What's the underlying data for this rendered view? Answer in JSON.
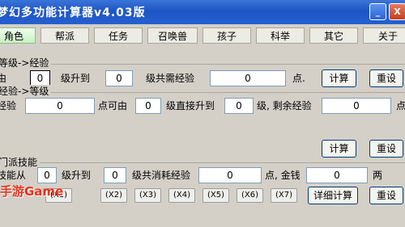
{
  "window": {
    "title": "梦幻多功能计算器v4.03版",
    "minimize_label": "_",
    "close_label": "X"
  },
  "tabs": [
    "角色",
    "帮派",
    "任务",
    "召唤兽",
    "孩子",
    "科举",
    "其它",
    "关于"
  ],
  "group_exp_level": {
    "title": "等级->经验",
    "level_prefix": "由",
    "from_level": "0",
    "upgrade_to_label": "级升到",
    "to_level": "0",
    "exp_needed_label": "级共需经验",
    "exp_needed": "0",
    "unit": "点.",
    "calc_label": "计算",
    "reset_label": "重设"
  },
  "group_level_exp": {
    "title": "经验->等级",
    "exp_label": "经验",
    "exp_value": "0",
    "from_label": "点可由",
    "from_level": "0",
    "upgrade_to_label": "级直接升到",
    "to_level": "0",
    "remaining_label": "级, 剩余经验",
    "remaining_value": "0",
    "unit": "点",
    "calc_label": "计算",
    "reset_label": "重设"
  },
  "group_skill": {
    "title": "门派技能",
    "skill_from_label": "技能从",
    "from_level": "0",
    "upgrade_to_label": "级升到",
    "to_level": "0",
    "total_exp_label": "级共消耗经验",
    "total_exp": "0",
    "gold_label": "点, 金钱",
    "gold_value": "0",
    "gold_unit": "两",
    "multipliers": [
      "(X1)",
      "(X2)",
      "(X3)",
      "(X4)",
      "(X5)",
      "(X6)",
      "(X7)"
    ],
    "detail_calc_label": "详细计算",
    "reset_label": "重设"
  },
  "watermark": "手游Game"
}
